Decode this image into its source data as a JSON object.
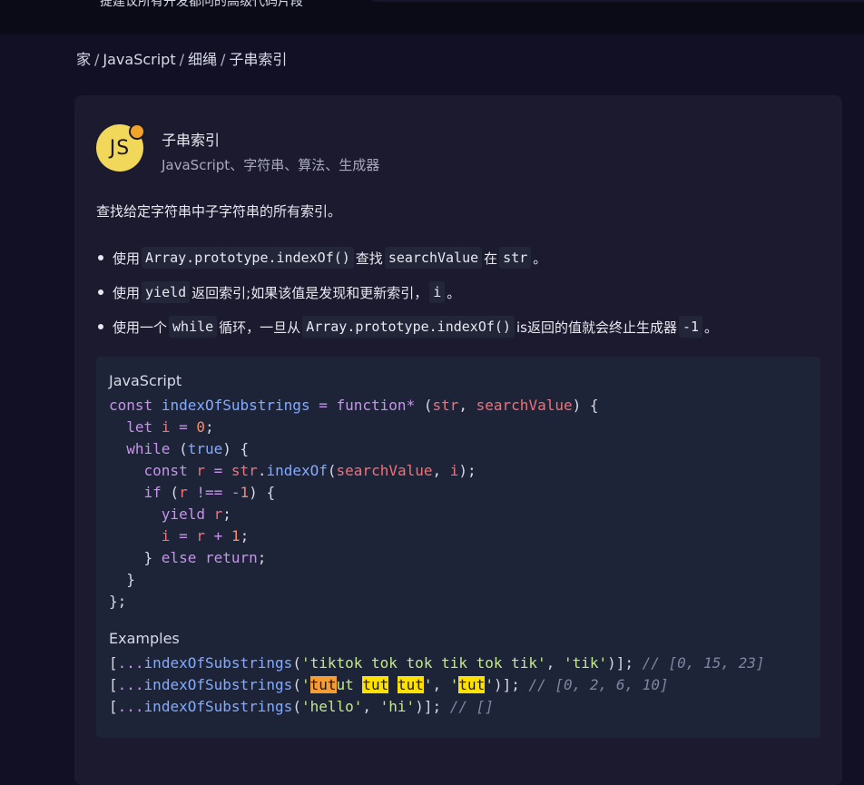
{
  "topbar": {
    "partial_text": "提建议所有开发都问的高级代码片段"
  },
  "breadcrumb": {
    "items": [
      "家",
      "JavaScript",
      "细绳",
      "子串索引"
    ],
    "separator": "/"
  },
  "card": {
    "avatar": {
      "label": "JS",
      "bg_color": "#f1d75a",
      "dot_color": "#f2a329"
    },
    "title": "子串索引",
    "tags": "JavaScript、字符串、算法、生成器",
    "description": "查找给定字符串中子字符串的所有索引。",
    "bullets": [
      {
        "parts": [
          {
            "type": "text",
            "value": "使用 "
          },
          {
            "type": "code",
            "value": "Array.prototype.indexOf()"
          },
          {
            "type": "text",
            "value": " 查找 "
          },
          {
            "type": "code",
            "value": "searchValue"
          },
          {
            "type": "text",
            "value": " 在 "
          },
          {
            "type": "code",
            "value": "str"
          },
          {
            "type": "text",
            "value": " 。"
          }
        ]
      },
      {
        "parts": [
          {
            "type": "text",
            "value": "使用 "
          },
          {
            "type": "code",
            "value": "yield"
          },
          {
            "type": "text",
            "value": " 返回索引;如果该值是发现和更新索引， "
          },
          {
            "type": "code",
            "value": "i"
          },
          {
            "type": "text",
            "value": " 。"
          }
        ]
      },
      {
        "parts": [
          {
            "type": "text",
            "value": "使用一个 "
          },
          {
            "type": "code",
            "value": "while"
          },
          {
            "type": "text",
            "value": " 循环，一旦从 "
          },
          {
            "type": "code",
            "value": "Array.prototype.indexOf()"
          },
          {
            "type": "text",
            "value": " is返回的值就会终止生成器 "
          },
          {
            "type": "code",
            "value": "-1"
          },
          {
            "type": "text",
            "value": " 。"
          }
        ]
      }
    ],
    "code": {
      "label": "JavaScript",
      "lines": [
        [
          {
            "t": "k",
            "v": "const"
          },
          {
            "t": "p",
            "v": " "
          },
          {
            "t": "f",
            "v": "indexOfSubstrings"
          },
          {
            "t": "p",
            "v": " "
          },
          {
            "t": "k",
            "v": "="
          },
          {
            "t": "p",
            "v": " "
          },
          {
            "t": "k",
            "v": "function*"
          },
          {
            "t": "p",
            "v": " ("
          },
          {
            "t": "v",
            "v": "str"
          },
          {
            "t": "p",
            "v": ", "
          },
          {
            "t": "v",
            "v": "searchValue"
          },
          {
            "t": "p",
            "v": ") {"
          }
        ],
        [
          {
            "t": "p",
            "v": "  "
          },
          {
            "t": "k",
            "v": "let"
          },
          {
            "t": "p",
            "v": " "
          },
          {
            "t": "v",
            "v": "i"
          },
          {
            "t": "p",
            "v": " "
          },
          {
            "t": "k",
            "v": "="
          },
          {
            "t": "p",
            "v": " "
          },
          {
            "t": "n",
            "v": "0"
          },
          {
            "t": "p",
            "v": ";"
          }
        ],
        [
          {
            "t": "p",
            "v": "  "
          },
          {
            "t": "k",
            "v": "while"
          },
          {
            "t": "p",
            "v": " ("
          },
          {
            "t": "b",
            "v": "true"
          },
          {
            "t": "p",
            "v": ") {"
          }
        ],
        [
          {
            "t": "p",
            "v": "    "
          },
          {
            "t": "k",
            "v": "const"
          },
          {
            "t": "p",
            "v": " "
          },
          {
            "t": "v",
            "v": "r"
          },
          {
            "t": "p",
            "v": " "
          },
          {
            "t": "k",
            "v": "="
          },
          {
            "t": "p",
            "v": " "
          },
          {
            "t": "v",
            "v": "str"
          },
          {
            "t": "p",
            "v": "."
          },
          {
            "t": "f",
            "v": "indexOf"
          },
          {
            "t": "p",
            "v": "("
          },
          {
            "t": "v",
            "v": "searchValue"
          },
          {
            "t": "p",
            "v": ", "
          },
          {
            "t": "v",
            "v": "i"
          },
          {
            "t": "p",
            "v": ");"
          }
        ],
        [
          {
            "t": "p",
            "v": "    "
          },
          {
            "t": "k",
            "v": "if"
          },
          {
            "t": "p",
            "v": " ("
          },
          {
            "t": "v",
            "v": "r"
          },
          {
            "t": "p",
            "v": " "
          },
          {
            "t": "k",
            "v": "!=="
          },
          {
            "t": "p",
            "v": " "
          },
          {
            "t": "k",
            "v": "-"
          },
          {
            "t": "n",
            "v": "1"
          },
          {
            "t": "p",
            "v": ") {"
          }
        ],
        [
          {
            "t": "p",
            "v": "      "
          },
          {
            "t": "k",
            "v": "yield"
          },
          {
            "t": "p",
            "v": " "
          },
          {
            "t": "v",
            "v": "r"
          },
          {
            "t": "p",
            "v": ";"
          }
        ],
        [
          {
            "t": "p",
            "v": "      "
          },
          {
            "t": "v",
            "v": "i"
          },
          {
            "t": "p",
            "v": " "
          },
          {
            "t": "k",
            "v": "="
          },
          {
            "t": "p",
            "v": " "
          },
          {
            "t": "v",
            "v": "r"
          },
          {
            "t": "p",
            "v": " "
          },
          {
            "t": "k",
            "v": "+"
          },
          {
            "t": "p",
            "v": " "
          },
          {
            "t": "n",
            "v": "1"
          },
          {
            "t": "p",
            "v": ";"
          }
        ],
        [
          {
            "t": "p",
            "v": "    } "
          },
          {
            "t": "k",
            "v": "else"
          },
          {
            "t": "p",
            "v": " "
          },
          {
            "t": "k",
            "v": "return"
          },
          {
            "t": "p",
            "v": ";"
          }
        ],
        [
          {
            "t": "p",
            "v": "  }"
          }
        ],
        [
          {
            "t": "p",
            "v": "};"
          }
        ]
      ]
    },
    "examples": {
      "label": "Examples",
      "lines": [
        [
          {
            "t": "p",
            "v": "["
          },
          {
            "t": "k",
            "v": "..."
          },
          {
            "t": "f",
            "v": "indexOfSubstrings"
          },
          {
            "t": "p",
            "v": "("
          },
          {
            "t": "s",
            "v": "'tiktok tok tok tik tok tik'"
          },
          {
            "t": "p",
            "v": ", "
          },
          {
            "t": "s",
            "v": "'tik'"
          },
          {
            "t": "p",
            "v": ")]; "
          },
          {
            "t": "c",
            "v": "// [0, 15, 23]"
          }
        ],
        [
          {
            "t": "p",
            "v": "["
          },
          {
            "t": "k",
            "v": "..."
          },
          {
            "t": "f",
            "v": "indexOfSubstrings"
          },
          {
            "t": "p",
            "v": "("
          },
          {
            "t": "s",
            "v": "'"
          },
          {
            "t": "hl2",
            "v": "tut"
          },
          {
            "t": "s",
            "v": "ut "
          },
          {
            "t": "hl",
            "v": "tut"
          },
          {
            "t": "s",
            "v": " "
          },
          {
            "t": "hl",
            "v": "tut"
          },
          {
            "t": "s",
            "v": "'"
          },
          {
            "t": "p",
            "v": ", "
          },
          {
            "t": "s",
            "v": "'"
          },
          {
            "t": "hl",
            "v": "tut"
          },
          {
            "t": "s",
            "v": "'"
          },
          {
            "t": "p",
            "v": ")]; "
          },
          {
            "t": "c",
            "v": "// [0, 2, 6, 10]"
          }
        ],
        [
          {
            "t": "p",
            "v": "["
          },
          {
            "t": "k",
            "v": "..."
          },
          {
            "t": "f",
            "v": "indexOfSubstrings"
          },
          {
            "t": "p",
            "v": "("
          },
          {
            "t": "s",
            "v": "'hello'"
          },
          {
            "t": "p",
            "v": ", "
          },
          {
            "t": "s",
            "v": "'hi'"
          },
          {
            "t": "p",
            "v": ")]; "
          },
          {
            "t": "c",
            "v": "// []"
          }
        ]
      ]
    }
  }
}
